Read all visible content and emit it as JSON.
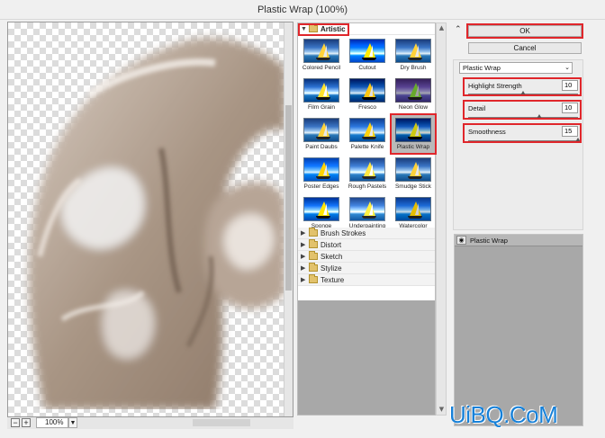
{
  "window": {
    "title": "Plastic Wrap (100%)"
  },
  "preview": {
    "zoom": "100%",
    "zoom_out_symbol": "−",
    "zoom_in_symbol": "+"
  },
  "gallery": {
    "open_category": "Artistic",
    "thumbnails": [
      {
        "label": "Colored Pencil"
      },
      {
        "label": "Cutout"
      },
      {
        "label": "Dry Brush"
      },
      {
        "label": "Film Grain"
      },
      {
        "label": "Fresco"
      },
      {
        "label": "Neon Glow"
      },
      {
        "label": "Paint Daubs"
      },
      {
        "label": "Palette Knife"
      },
      {
        "label": "Plastic Wrap"
      },
      {
        "label": "Poster Edges"
      },
      {
        "label": "Rough Pastels"
      },
      {
        "label": "Smudge Stick"
      },
      {
        "label": "Sponge"
      },
      {
        "label": "Underpainting"
      },
      {
        "label": "Watercolor"
      }
    ],
    "selected_filter": "Plastic Wrap",
    "categories": [
      {
        "label": "Brush Strokes"
      },
      {
        "label": "Distort"
      },
      {
        "label": "Sketch"
      },
      {
        "label": "Stylize"
      },
      {
        "label": "Texture"
      }
    ]
  },
  "controls": {
    "ok_label": "OK",
    "cancel_label": "Cancel",
    "filter_select": "Plastic Wrap",
    "params": [
      {
        "label": "Highlight Strength",
        "value": "10",
        "min": 0,
        "max": 20
      },
      {
        "label": "Detail",
        "value": "10",
        "min": 1,
        "max": 15
      },
      {
        "label": "Smoothness",
        "value": "15",
        "min": 1,
        "max": 15
      }
    ]
  },
  "layers": [
    {
      "name": "Plastic Wrap",
      "visible": true
    }
  ],
  "watermark": "UiBQ.CoM",
  "colors": {
    "highlight": "#e0262b",
    "watermark": "#1680d8",
    "selected_thumb": "#b9b9b9"
  }
}
